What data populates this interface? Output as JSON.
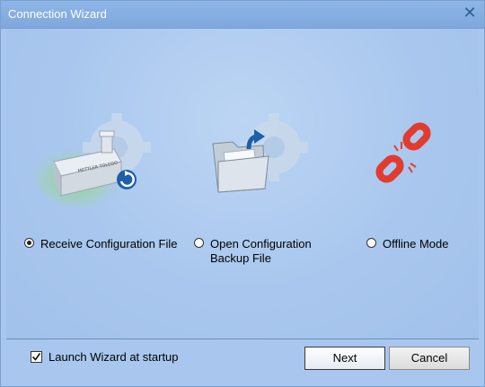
{
  "window": {
    "title": "Connection Wizard"
  },
  "options": [
    {
      "label": "Receive Configuration File",
      "selected": true,
      "icon": "device-receive-icon"
    },
    {
      "label_line1": "Open Configuration",
      "label_line2": "Backup File",
      "selected": false,
      "icon": "open-folder-icon"
    },
    {
      "label": "Offline Mode",
      "selected": false,
      "icon": "broken-link-icon"
    }
  ],
  "device_brand": "METTLER TOLEDO",
  "footer": {
    "launch_checkbox_label": "Launch Wizard at startup",
    "launch_checked": true,
    "next_label": "Next",
    "cancel_label": "Cancel"
  },
  "colors": {
    "background": "#a9c7ee",
    "titlebar": "#8eb5e6",
    "link_red": "#e23b2f"
  }
}
